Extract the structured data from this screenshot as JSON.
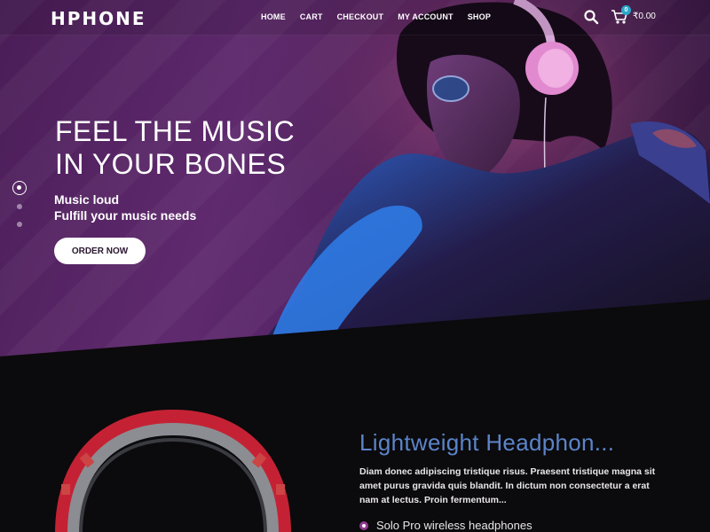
{
  "brand": {
    "logo": "HPHONE"
  },
  "nav": {
    "items": [
      "HOME",
      "CART",
      "CHECKOUT",
      "MY ACCOUNT",
      "SHOP"
    ]
  },
  "header": {
    "cart_count": "0",
    "cart_total": "₹0.00",
    "icons": [
      "search-icon",
      "cart-icon"
    ]
  },
  "hero": {
    "title_line1": "FEEL THE MUSIC",
    "title_line2": "IN YOUR BONES",
    "sub_line1": "Music loud",
    "sub_line2": "Fulfill your music needs",
    "cta_label": "ORDER NOW",
    "slides_count": 3,
    "active_slide": 1
  },
  "product": {
    "title": "Lightweight Headphon...",
    "description": "Diam donec adipiscing tristique risus. Praesent tristique magna sit amet purus gravida quis blandit. In dictum non consectetur a erat nam at lectus. Proin fermentum...",
    "features": [
      "Solo Pro wireless headphones"
    ]
  },
  "colors": {
    "hero_purple": "#5f2a6e",
    "title_blue": "#5b84c9",
    "badge": "#2aa7c9",
    "bullet": "#8e3a8f",
    "headphone_red": "#d0283a"
  }
}
